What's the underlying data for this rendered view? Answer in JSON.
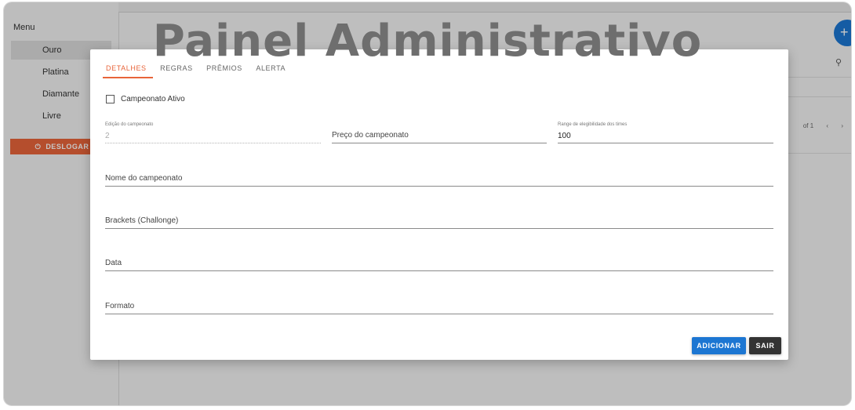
{
  "sidebar": {
    "menu_title": "Menu",
    "items": [
      {
        "label": "Ouro"
      },
      {
        "label": "Platina"
      },
      {
        "label": "Diamante"
      },
      {
        "label": "Livre"
      }
    ],
    "logout_label": "DESLOGAR",
    "logout_icon": "power-icon"
  },
  "background": {
    "fab_icon": "add-icon",
    "search_icon": "search-icon",
    "pager_text": "of 1",
    "prev_icon": "chevron-left-icon",
    "next_icon": "chevron-right-icon"
  },
  "watermark": "Painel Administrativo",
  "modal": {
    "tabs": [
      "DETALHES",
      "REGRAS",
      "PRÊMIOS",
      "ALERTA"
    ],
    "active_tab": "DETALHES",
    "checkbox_label": "Campeonato Ativo",
    "checkbox_checked": false,
    "fields": {
      "edicao_label": "Edição do campeonato",
      "edicao_value": "2",
      "preco_label": "Preço do campeonato",
      "range_label": "Range de elegibilidade dos times",
      "range_value": "100",
      "nome_label": "Nome do campeonato",
      "brackets_label": "Brackets (Challonge)",
      "data_label": "Data",
      "formato_label": "Formato"
    },
    "add_button": "ADICIONAR",
    "exit_button": "SAIR"
  },
  "colors": {
    "accent": "#e8643a",
    "primary": "#1c76d2",
    "dark_button": "#333333"
  }
}
